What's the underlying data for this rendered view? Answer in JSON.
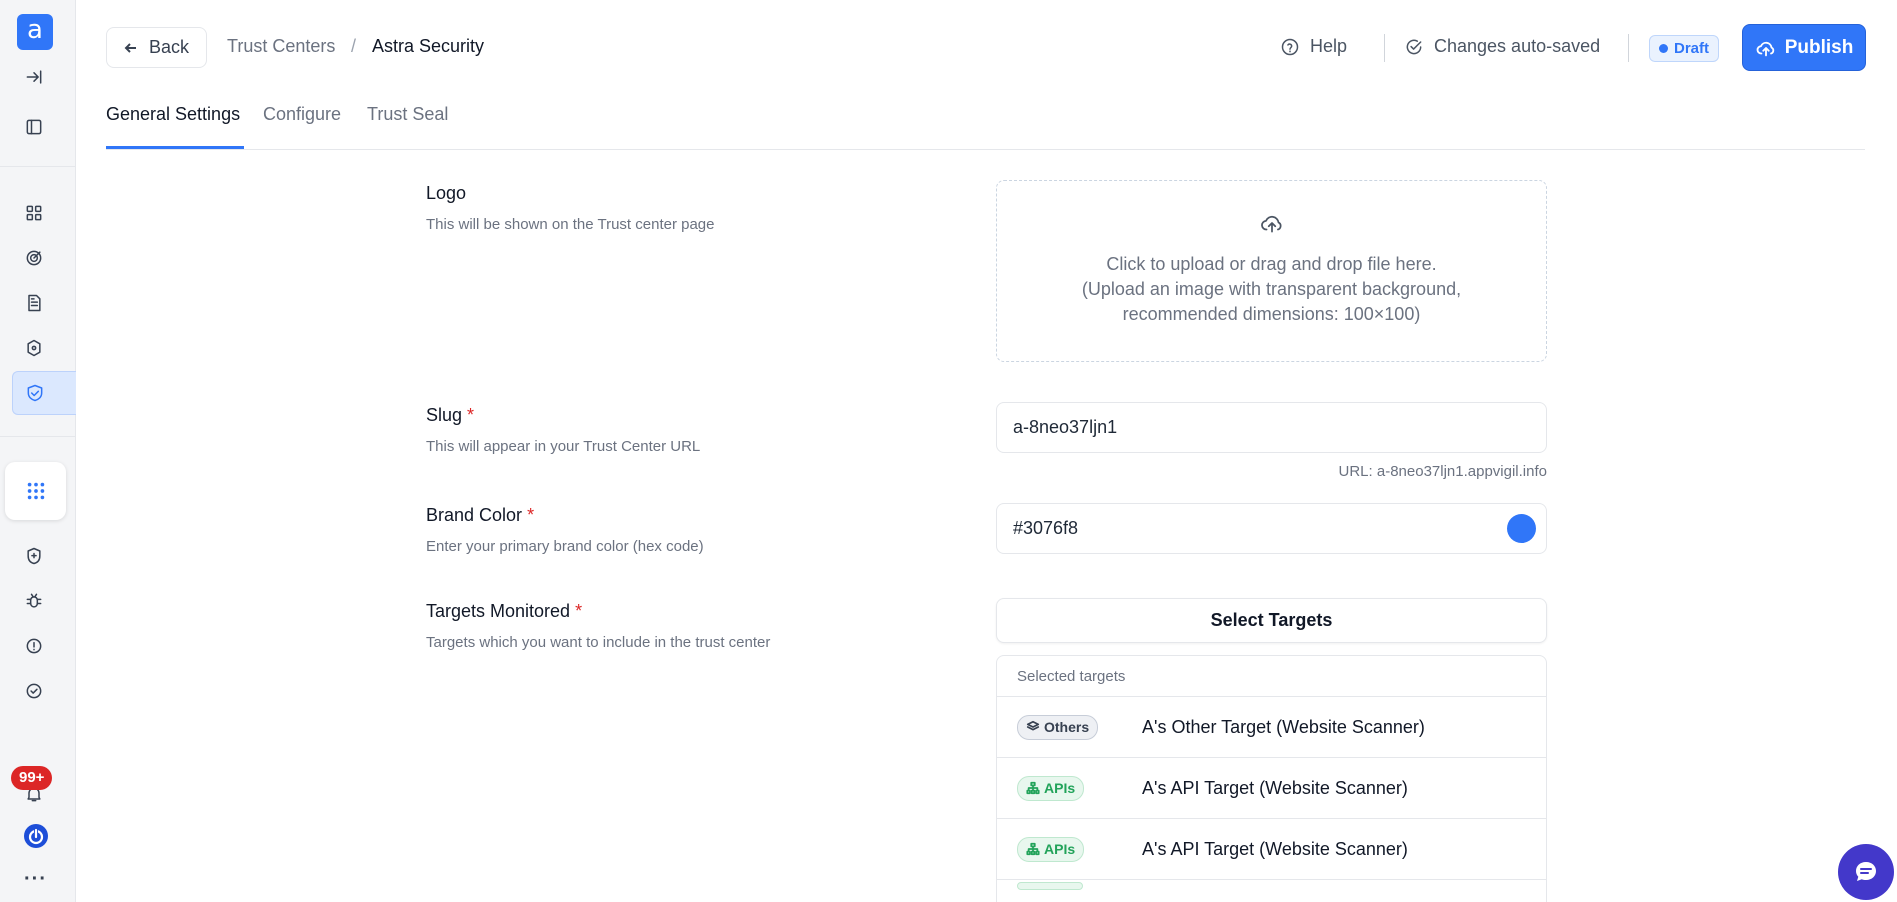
{
  "sidebar": {
    "logo_letter": "a",
    "badge": "99+",
    "more": "···",
    "icons": [
      "expand-icon",
      "panel-icon",
      "dashboard-icon",
      "target-icon",
      "document-icon",
      "integrations-icon",
      "trust-center-icon",
      "apps-grid-icon",
      "shield-icon",
      "bug-icon",
      "alert-icon",
      "check-circle-icon",
      "bell-icon",
      "power-icon"
    ]
  },
  "header": {
    "back_label": "Back",
    "breadcrumb": [
      "Trust Centers",
      "Astra Security"
    ],
    "breadcrumb_separator": "/",
    "help_label": "Help",
    "autosave_label": "Changes auto-saved",
    "status_badge": "Draft",
    "publish_label": "Publish"
  },
  "tabs": [
    {
      "label": "General Settings",
      "active": true
    },
    {
      "label": "Configure",
      "active": false
    },
    {
      "label": "Trust Seal",
      "active": false
    }
  ],
  "form": {
    "logo": {
      "label": "Logo",
      "description": "This will be shown on the Trust center page",
      "upload_line1": "Click to upload or drag and drop file here.",
      "upload_line2": "(Upload an image with transparent background,",
      "upload_line3": "recommended dimensions: 100×100)"
    },
    "slug": {
      "label": "Slug",
      "required_mark": "*",
      "description": "This will appear in your Trust Center URL",
      "value": "a-8neo37ljn1",
      "url_note": "URL: a-8neo37ljn1.appvigil.info"
    },
    "brand_color": {
      "label": "Brand Color",
      "required_mark": "*",
      "description": "Enter your primary brand color (hex code)",
      "value": "#3076f8",
      "swatch_color": "#3076f8"
    },
    "targets": {
      "label": "Targets Monitored",
      "required_mark": "*",
      "description": "Targets which you want to include in the trust center",
      "select_button": "Select Targets",
      "selected_header": "Selected targets",
      "items": [
        {
          "badge": "Others",
          "badge_type": "others",
          "name": "A's Other Target (Website Scanner)"
        },
        {
          "badge": "APIs",
          "badge_type": "apis",
          "name": "A's API Target (Website Scanner)"
        },
        {
          "badge": "APIs",
          "badge_type": "apis",
          "name": "A's API Target (Website Scanner)"
        }
      ]
    }
  },
  "colors": {
    "accent": "#3076f8",
    "required": "#dc2626",
    "apis_badge": "#22a35a",
    "chat": "#4338ca"
  }
}
